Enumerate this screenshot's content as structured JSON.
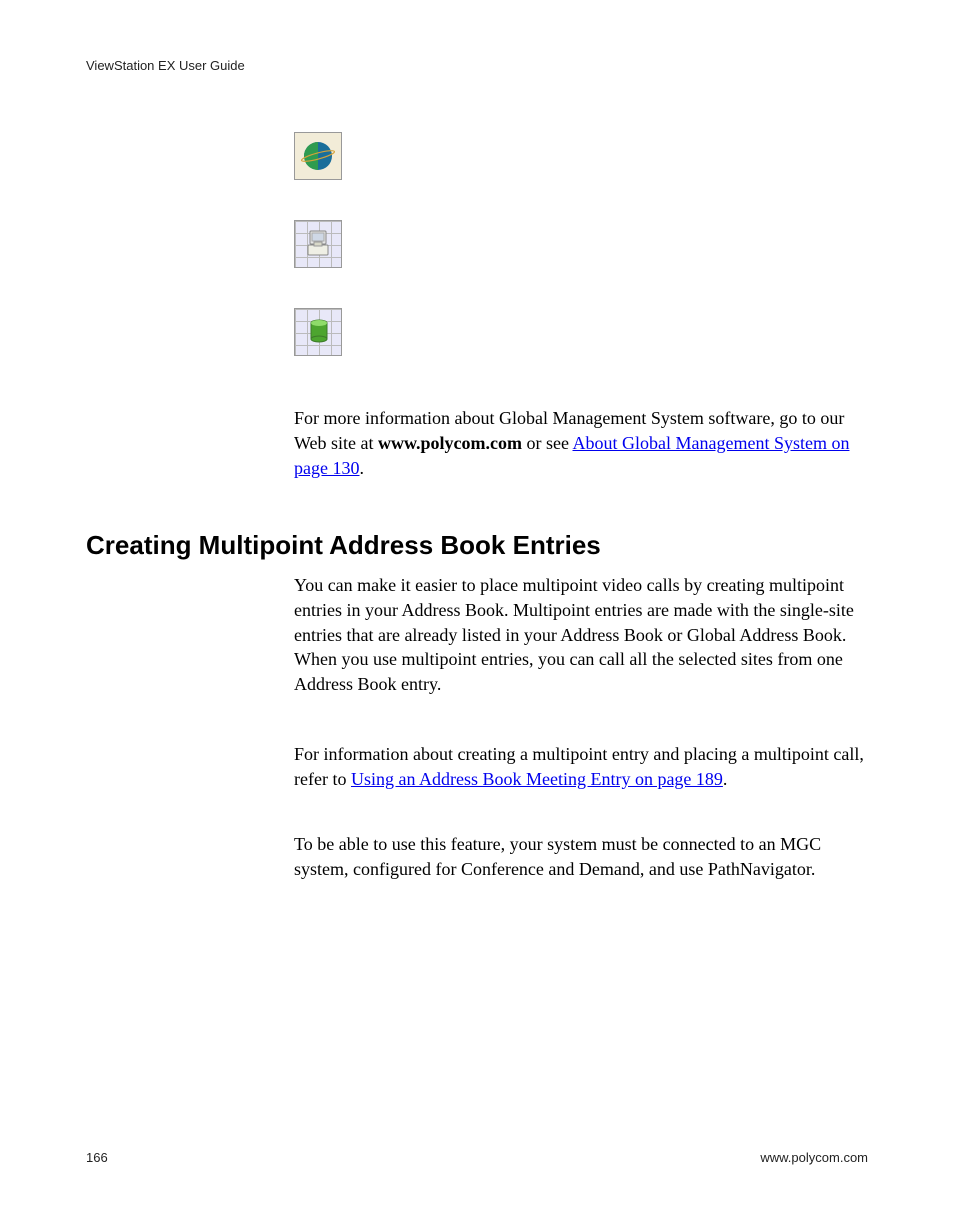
{
  "header": {
    "title": "ViewStation EX User Guide"
  },
  "icons": {
    "globe": "globe-icon",
    "computer": "computer-icon",
    "cylinder": "cylinder-icon"
  },
  "para1": {
    "pre": "For more information about Global Management System software, go to our Web site at ",
    "bold": "www.polycom.com",
    "mid": " or see ",
    "link": "About Global Management System on page 130",
    "post": "."
  },
  "heading": "Creating Multipoint Address Book Entries",
  "para_intro": "You can make it easier to place multipoint video calls by creating multipoint entries in your Address Book. Multipoint entries are made with the single-site entries that are already listed in your Address Book or Global Address Book. When you use multipoint entries, you can call all the selected sites from one Address Book entry.",
  "para_info": {
    "pre": "For information about creating a multipoint entry and placing a multipoint call, refer to ",
    "link": "Using an Address Book Meeting Entry on page 189",
    "post": "."
  },
  "para_able": "To be able to use this feature, your system must be connected to an MGC system, configured for Conference and Demand, and use PathNavigator.",
  "footer": {
    "page": "166",
    "site": "www.polycom.com"
  }
}
